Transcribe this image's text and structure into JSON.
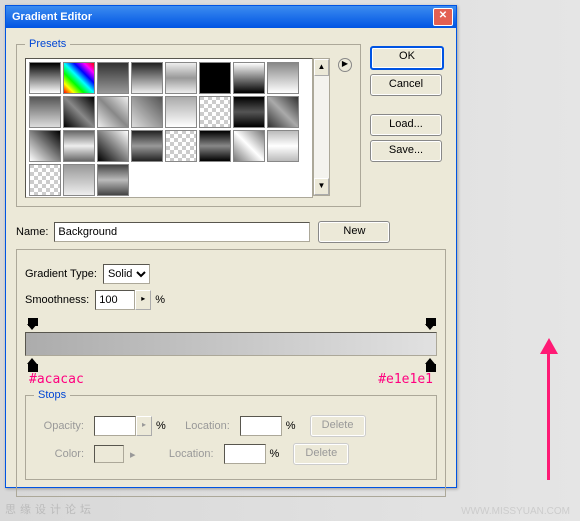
{
  "title": "Gradient Editor",
  "presets_legend": "Presets",
  "buttons": {
    "ok": "OK",
    "cancel": "Cancel",
    "load": "Load...",
    "save": "Save...",
    "new": "New",
    "delete": "Delete"
  },
  "name_label": "Name:",
  "name_value": "Background",
  "gradient_type_label": "Gradient Type:",
  "gradient_type_value": "Solid",
  "smoothness_label": "Smoothness:",
  "smoothness_value": "100",
  "percent": "%",
  "hex_left": "#acacac",
  "hex_right": "#e1e1e1",
  "stops_legend": "Stops",
  "opacity_label": "Opacity:",
  "color_label": "Color:",
  "location_label": "Location:",
  "swatches": [
    "linear-gradient(#000,#fff)",
    "linear-gradient(45deg,#f00,#ff0,#0f0,#0ff,#00f,#f0f,#f00)",
    "linear-gradient(#333,#999)",
    "linear-gradient(#222,#eee)",
    "linear-gradient(#eee,#999,#eee)",
    "linear-gradient(#000,#000)",
    "linear-gradient(#fff,#000)",
    "linear-gradient(#888,#fff)",
    "linear-gradient(#555,#ddd)",
    "linear-gradient(45deg,#000,#888,#000)",
    "linear-gradient(45deg,#eee,#888,#eee)",
    "linear-gradient(45deg,#ddd,#555)",
    "linear-gradient(#aaa,#fff)",
    "repeating-conic-gradient(#ccc 0 25%,#fff 0 50%) 0/8px 8px",
    "linear-gradient(#000,#555,#000)",
    "linear-gradient(45deg,#333,#aaa,#333)",
    "linear-gradient(45deg,#fff,#000)",
    "linear-gradient(#666,#eee,#666)",
    "linear-gradient(45deg,#000,#fff)",
    "linear-gradient(#222,#999,#222)",
    "repeating-conic-gradient(#ccc 0 25%,#fff 0 50%) 0/8px 8px",
    "linear-gradient(#000,#888,#000)",
    "linear-gradient(45deg,#777,#fff,#777)",
    "linear-gradient(#bbb,#fff,#bbb)",
    "repeating-conic-gradient(#ccc 0 25%,#fff 0 50%) 0/8px 8px",
    "linear-gradient(#999,#eee)",
    "linear-gradient(#444,#bbb,#444)"
  ],
  "watermark": "思缘设计论坛",
  "watermark2": "WWW.MISSYUAN.COM"
}
